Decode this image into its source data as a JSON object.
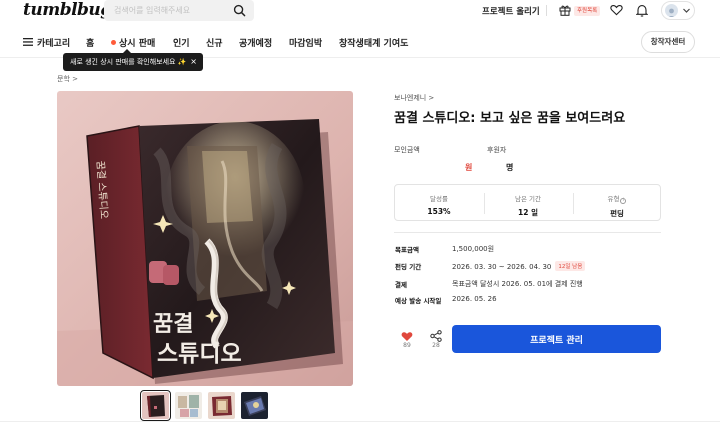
{
  "header": {
    "logo": "tumblbug",
    "search_placeholder": "검색어를 입력해주세요",
    "launch_project": "프로젝트 올리기",
    "supporter_badge": "후원목록"
  },
  "nav": {
    "items": [
      "카테고리",
      "홈",
      "상시 판매",
      "인기",
      "신규",
      "공개예정",
      "마감임박",
      "창작생태계 기여도"
    ],
    "creator_center": "창작자센터"
  },
  "tooltip": {
    "text": "새로 생긴 상시 판매를 확인해보세요 ✨",
    "close": "×"
  },
  "breadcrumb": "문학 >",
  "project": {
    "creator": "보나엔제니 >",
    "title": "꿈결 스튜디오: 보고 싶은 꿈을 보여드려요",
    "raised_label": "모인금액",
    "backers_label": "후원자",
    "raised_value": "원",
    "backers_value": "명",
    "stats": [
      {
        "label": "달성률",
        "value": "153%"
      },
      {
        "label": "남은 기간",
        "value": "12 일"
      },
      {
        "label": "유형",
        "value": "펀딩"
      }
    ],
    "details": [
      {
        "label": "목표금액",
        "value": "1,500,000원"
      },
      {
        "label": "펀딩 기간",
        "value": "2026. 03. 30 ~ 2026. 04. 30",
        "badge": "12일 남음"
      },
      {
        "label": "결제",
        "value": "목표금액 달성시 2026. 05. 01에 결제 진행"
      },
      {
        "label": "예상 발송 시작일",
        "value": "2026. 05. 26"
      }
    ],
    "likes": "89",
    "shares": "28",
    "manage_button": "프로젝트 관리"
  },
  "cover": {
    "title_line1": "꿈결",
    "title_line2": "스튜디오",
    "spine": "꿈결 스튜디오"
  },
  "colors": {
    "accent": "#1a56db",
    "brand_red": "#e0483d"
  }
}
